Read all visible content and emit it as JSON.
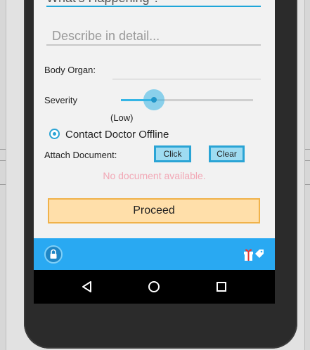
{
  "form": {
    "top_field_text": "What's Happening ?",
    "describe_placeholder": "Describe in detail...",
    "body_organ_label": "Body Organ:",
    "body_organ_value": "",
    "severity_label": "Severity",
    "severity_value_label": "(Low)",
    "severity_level": 0.25,
    "contact_option_label": "Contact Doctor Offline",
    "attach_label": "Attach Document:",
    "click_button": "Click",
    "clear_button": "Clear",
    "no_document_text": "No document available.",
    "proceed_button": "Proceed"
  },
  "toolbar": {
    "left_icon": "lock-icon",
    "right_icon": "gift-tag-icon"
  },
  "navigation": {
    "back_icon": "back-triangle-icon",
    "home_icon": "home-circle-icon",
    "recents_icon": "recents-square-icon"
  },
  "colors": {
    "accent": "#29a9f2",
    "proceed_fill": "#ffdfaa",
    "proceed_border": "#f0b24a",
    "warning_text": "#f2a7b5"
  }
}
